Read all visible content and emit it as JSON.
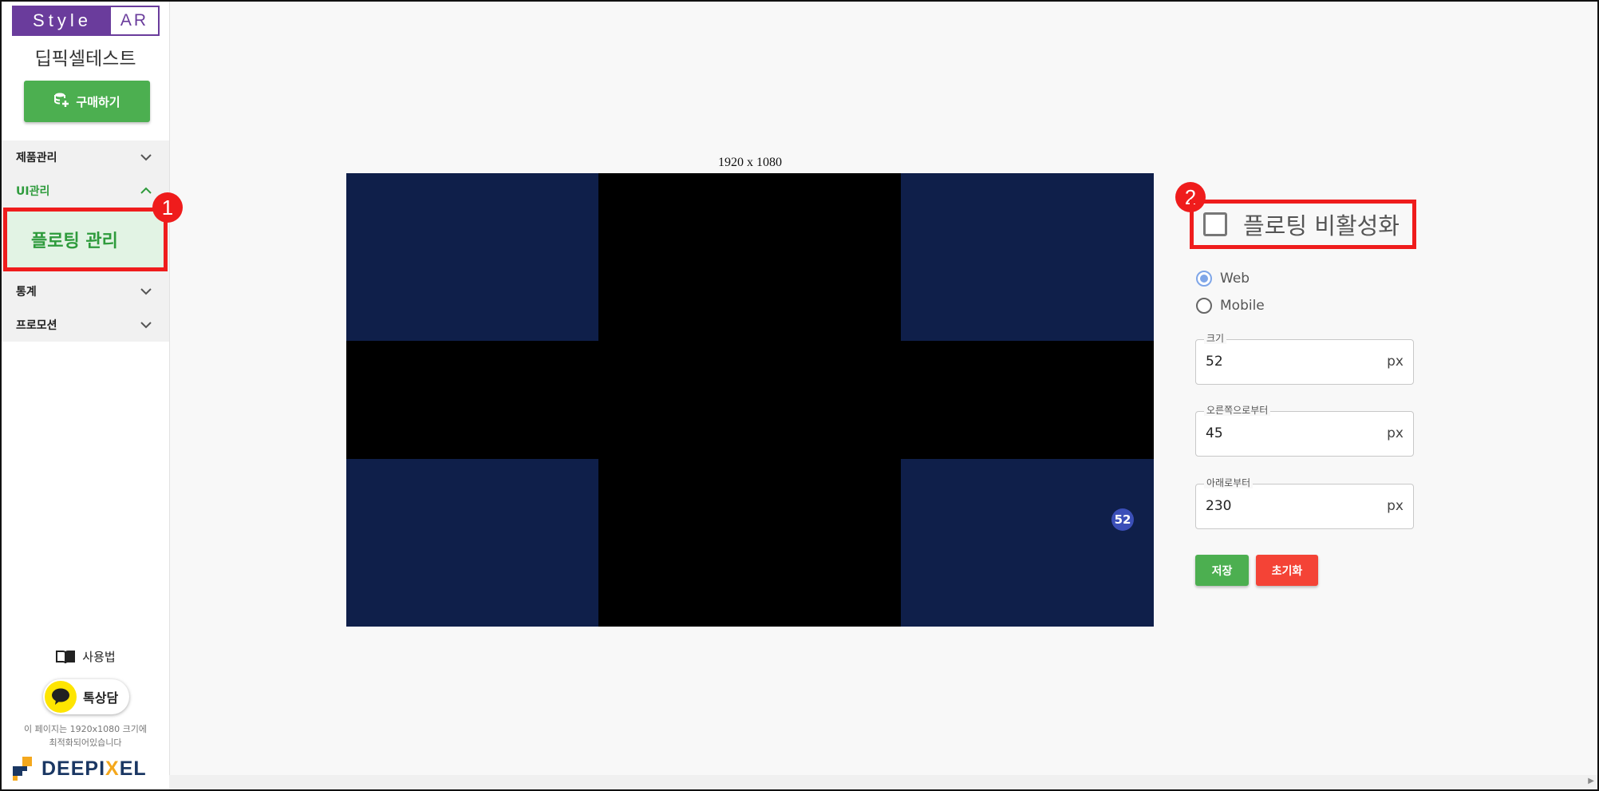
{
  "brand": {
    "style": "Style",
    "ar": "AR"
  },
  "shop_name": "딥픽셀테스트",
  "buy_button": "구매하기",
  "menu": {
    "items": [
      {
        "label": "제품관리",
        "expanded": false
      },
      {
        "label": "UI관리",
        "expanded": true
      },
      {
        "label": "통계",
        "expanded": false
      },
      {
        "label": "프로모션",
        "expanded": false
      }
    ],
    "submenu_active": "플로팅 관리"
  },
  "markers": {
    "one": "1",
    "two": "2"
  },
  "manual_label": "사용법",
  "kakao_label": "톡상담",
  "notice": {
    "line1": "이 페이지는 1920x1080 크기에",
    "line2": "최적화되어있습니다"
  },
  "logo": {
    "part1": "DEEPI",
    "x": "X",
    "part2": "EL"
  },
  "preview": {
    "resolution": "1920 x 1080",
    "floating_size_label": "52"
  },
  "settings": {
    "disable_label": "플로팅 비활성화",
    "disable_checked": false,
    "radio": [
      {
        "label": "Web",
        "checked": true
      },
      {
        "label": "Mobile",
        "checked": false
      }
    ],
    "fields": [
      {
        "label": "크기",
        "value": "52",
        "unit": "px"
      },
      {
        "label": "오른쪽으로부터",
        "value": "45",
        "unit": "px"
      },
      {
        "label": "아래로부터",
        "value": "230",
        "unit": "px"
      }
    ],
    "save_label": "저장",
    "reset_label": "초기화"
  },
  "colors": {
    "brand_purple": "#6a3c9c",
    "green": "#4caf50",
    "red": "#f44336",
    "highlight_red": "#ef1c1c",
    "navy": "#0f1f4a",
    "floating_blue": "#3b4fb8"
  },
  "icons": {
    "buy": "database-plus-icon",
    "chevron_down": "chevron-down-icon",
    "chevron_up": "chevron-up-icon",
    "manual": "book-icon",
    "kakao": "chat-bubble-icon",
    "logo": "deepixel-logo-mark"
  }
}
